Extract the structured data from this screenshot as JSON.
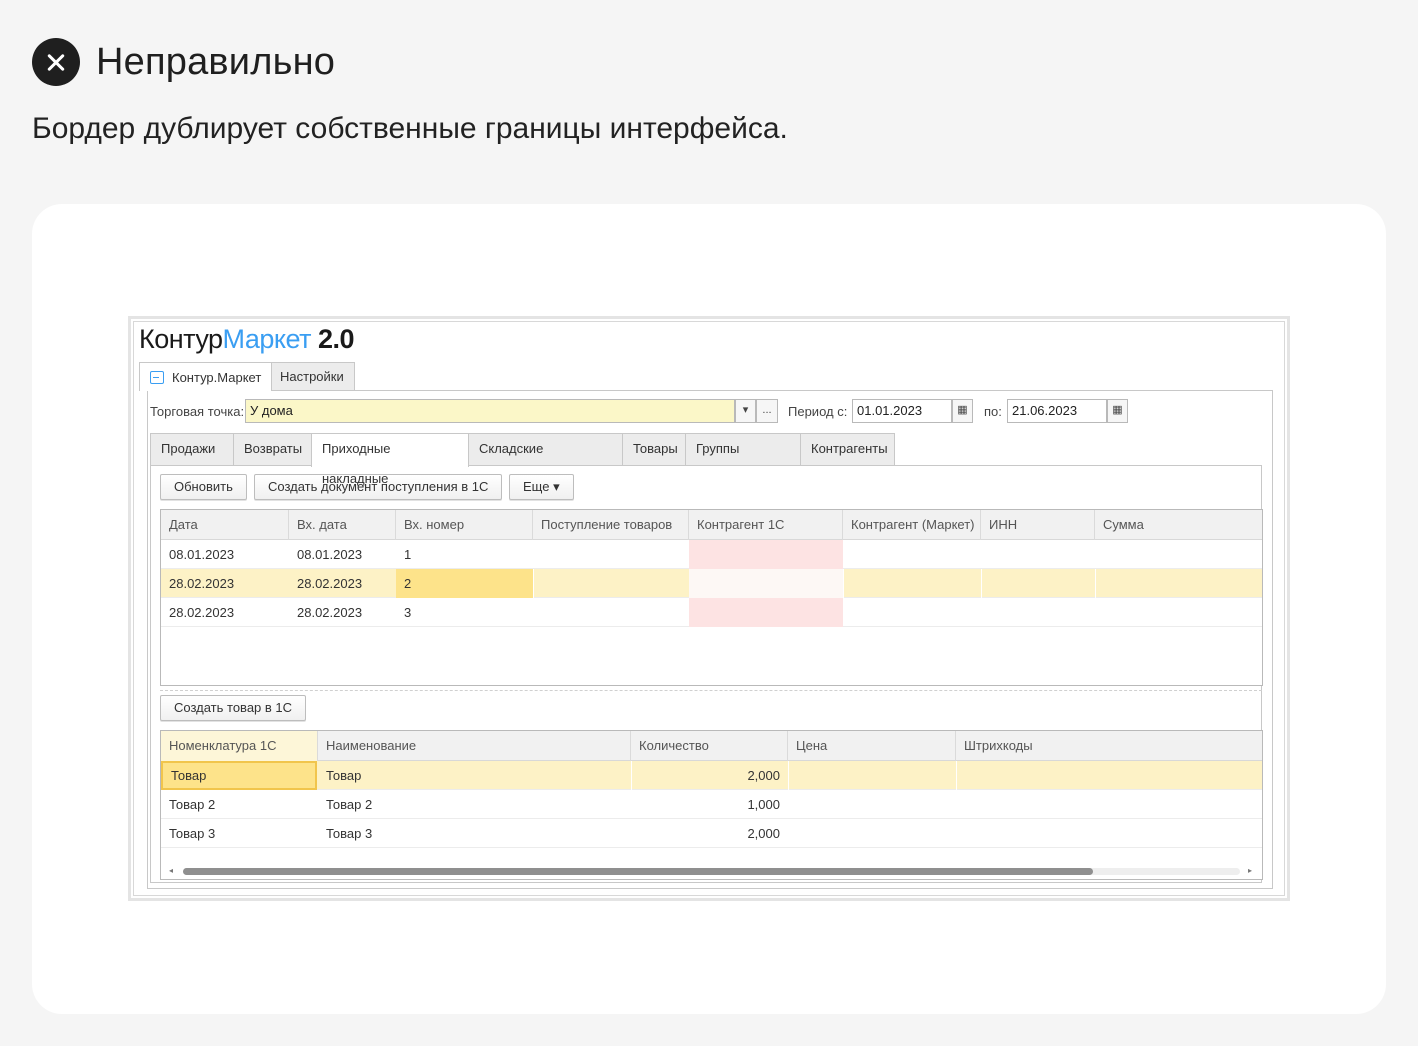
{
  "status": {
    "title": "Неправильно",
    "description": "Бордер дублирует собственные границы интерфейса."
  },
  "brand": {
    "part1": "Контур",
    "part2": "Маркет",
    "part3": "2.0"
  },
  "app_tabs": [
    "Контур.Маркет",
    "Настройки"
  ],
  "filters": {
    "store_label": "Торговая точка:",
    "store_value": "У дома",
    "store_dropdown": "▾",
    "store_more": "...",
    "period_from_label": "Период с:",
    "period_from_value": "01.01.2023",
    "period_to_label": "по:",
    "period_to_value": "21.06.2023"
  },
  "section_tabs": [
    "Продажи",
    "Возвраты",
    "Приходные накладные",
    "Складские документы",
    "Товары",
    "Группы товаров",
    "Контрагенты"
  ],
  "toolbar": {
    "refresh": "Обновить",
    "create_doc": "Создать документ поступления в 1С",
    "more": "Еще ▾"
  },
  "invoices": {
    "columns": [
      "Дата",
      "Вх. дата",
      "Вх. номер",
      "Поступление товаров",
      "Контрагент 1С",
      "Контрагент (Маркет)",
      "ИНН",
      "Сумма"
    ],
    "rows": [
      [
        "08.01.2023",
        "08.01.2023",
        "1",
        "",
        "",
        "",
        "",
        ""
      ],
      [
        "28.02.2023",
        "28.02.2023",
        "2",
        "",
        "",
        "",
        "",
        ""
      ],
      [
        "28.02.2023",
        "28.02.2023",
        "3",
        "",
        "",
        "",
        "",
        ""
      ]
    ]
  },
  "goods_toolbar": {
    "create_item": "Создать товар в 1С"
  },
  "goods": {
    "columns": [
      "Номенклатура 1С",
      "Наименование",
      "Количество",
      "Цена",
      "Штрихкоды"
    ],
    "rows": [
      [
        "Товар",
        "Товар",
        "2,000",
        "",
        ""
      ],
      [
        "Товар 2",
        "Товар 2",
        "1,000",
        "",
        ""
      ],
      [
        "Товар 3",
        "Товар 3",
        "2,000",
        "",
        ""
      ]
    ]
  },
  "scrollbar": {
    "left_arrow": "◂",
    "right_arrow": "▸"
  },
  "colors": {
    "brand_blue": "#3a9ef2",
    "selected_row": "#fdf2c6",
    "current_cell": "#fde38a",
    "warning_cell": "#fde3e3",
    "field_highlight": "#fbf7c8"
  }
}
